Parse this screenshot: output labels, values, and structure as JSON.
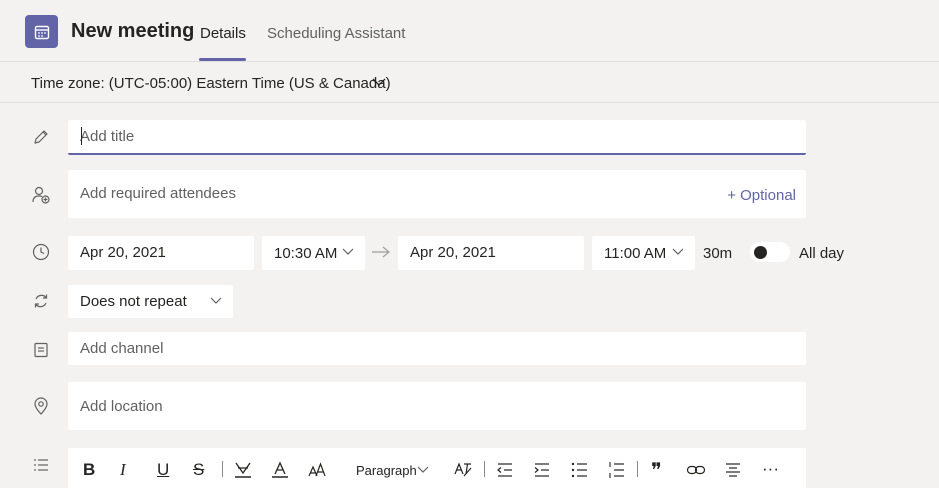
{
  "header": {
    "title": "New meeting",
    "tabs": [
      {
        "label": "Details",
        "active": true
      },
      {
        "label": "Scheduling Assistant",
        "active": false
      }
    ],
    "accent": "#6264a7"
  },
  "timezone": {
    "label": "Time zone: (UTC-05:00) Eastern Time (US & Canada)"
  },
  "form": {
    "title_placeholder": "Add title",
    "attendees_placeholder": "Add required attendees",
    "optional_label": "+ Optional",
    "start_date": "Apr 20, 2021",
    "start_time": "10:30 AM",
    "end_date": "Apr 20, 2021",
    "end_time": "11:00 AM",
    "duration": "30m",
    "all_day_label": "All day",
    "all_day_on": false,
    "repeat": "Does not repeat",
    "channel_placeholder": "Add channel",
    "location_placeholder": "Add location"
  },
  "toolbar": {
    "bold": "B",
    "italic": "I",
    "underline": "U",
    "strike": "S",
    "font_size": "A",
    "paragraph": "Paragraph",
    "more": "···"
  }
}
